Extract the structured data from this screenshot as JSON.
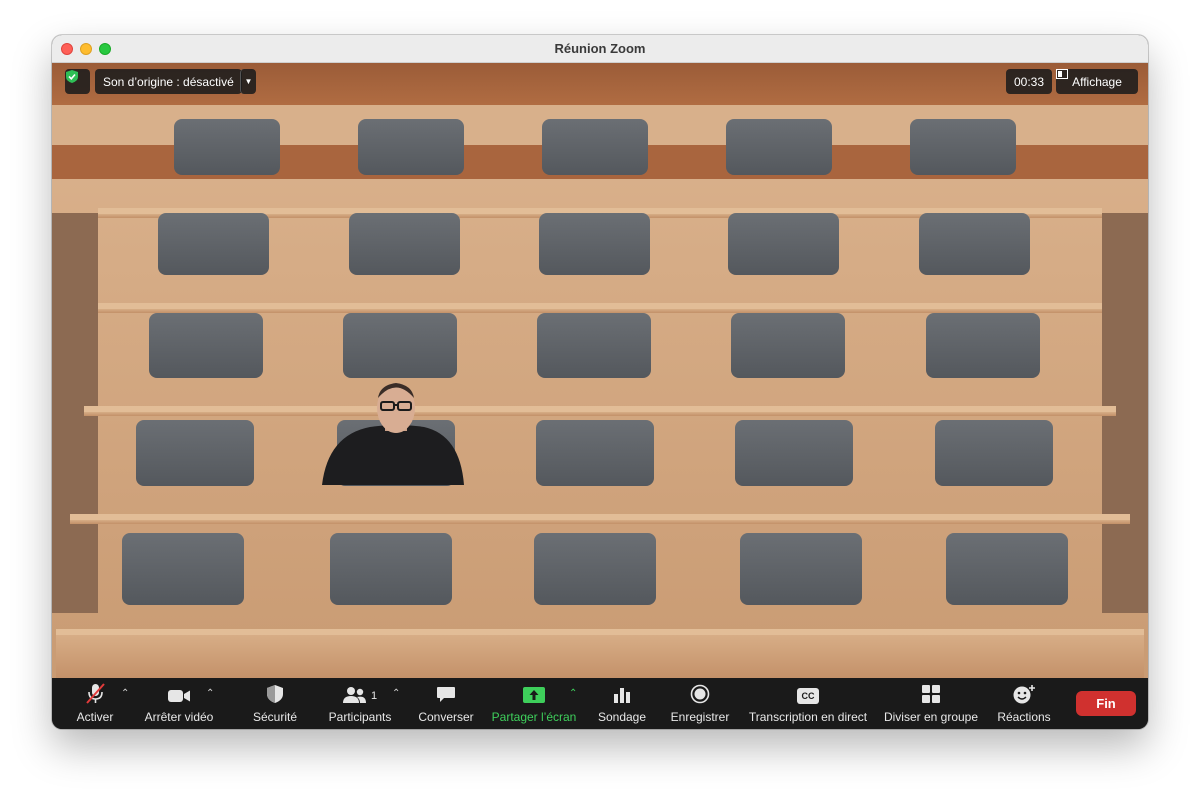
{
  "window": {
    "title": "Réunion Zoom"
  },
  "meeting": {
    "audio_label": "Son d’origine : désactivé",
    "timer": "00:33",
    "view_label": "Affichage",
    "participant_count": "1"
  },
  "toolbar": {
    "mute_label": "Activer",
    "video_label": "Arrêter vidéo",
    "security_label": "Sécurité",
    "participants_label": "Participants",
    "chat_label": "Converser",
    "share_label": "Partager l’écran",
    "poll_label": "Sondage",
    "record_label": "Enregistrer",
    "captions_label": "Transcription en direct",
    "breakout_label": "Diviser en groupe",
    "reactions_label": "Réactions",
    "end_label": "Fin",
    "cc_glyph": "CC"
  },
  "colors": {
    "end": "#d0312f",
    "share": "#3ecf5b",
    "shield": "#2fbf56"
  }
}
